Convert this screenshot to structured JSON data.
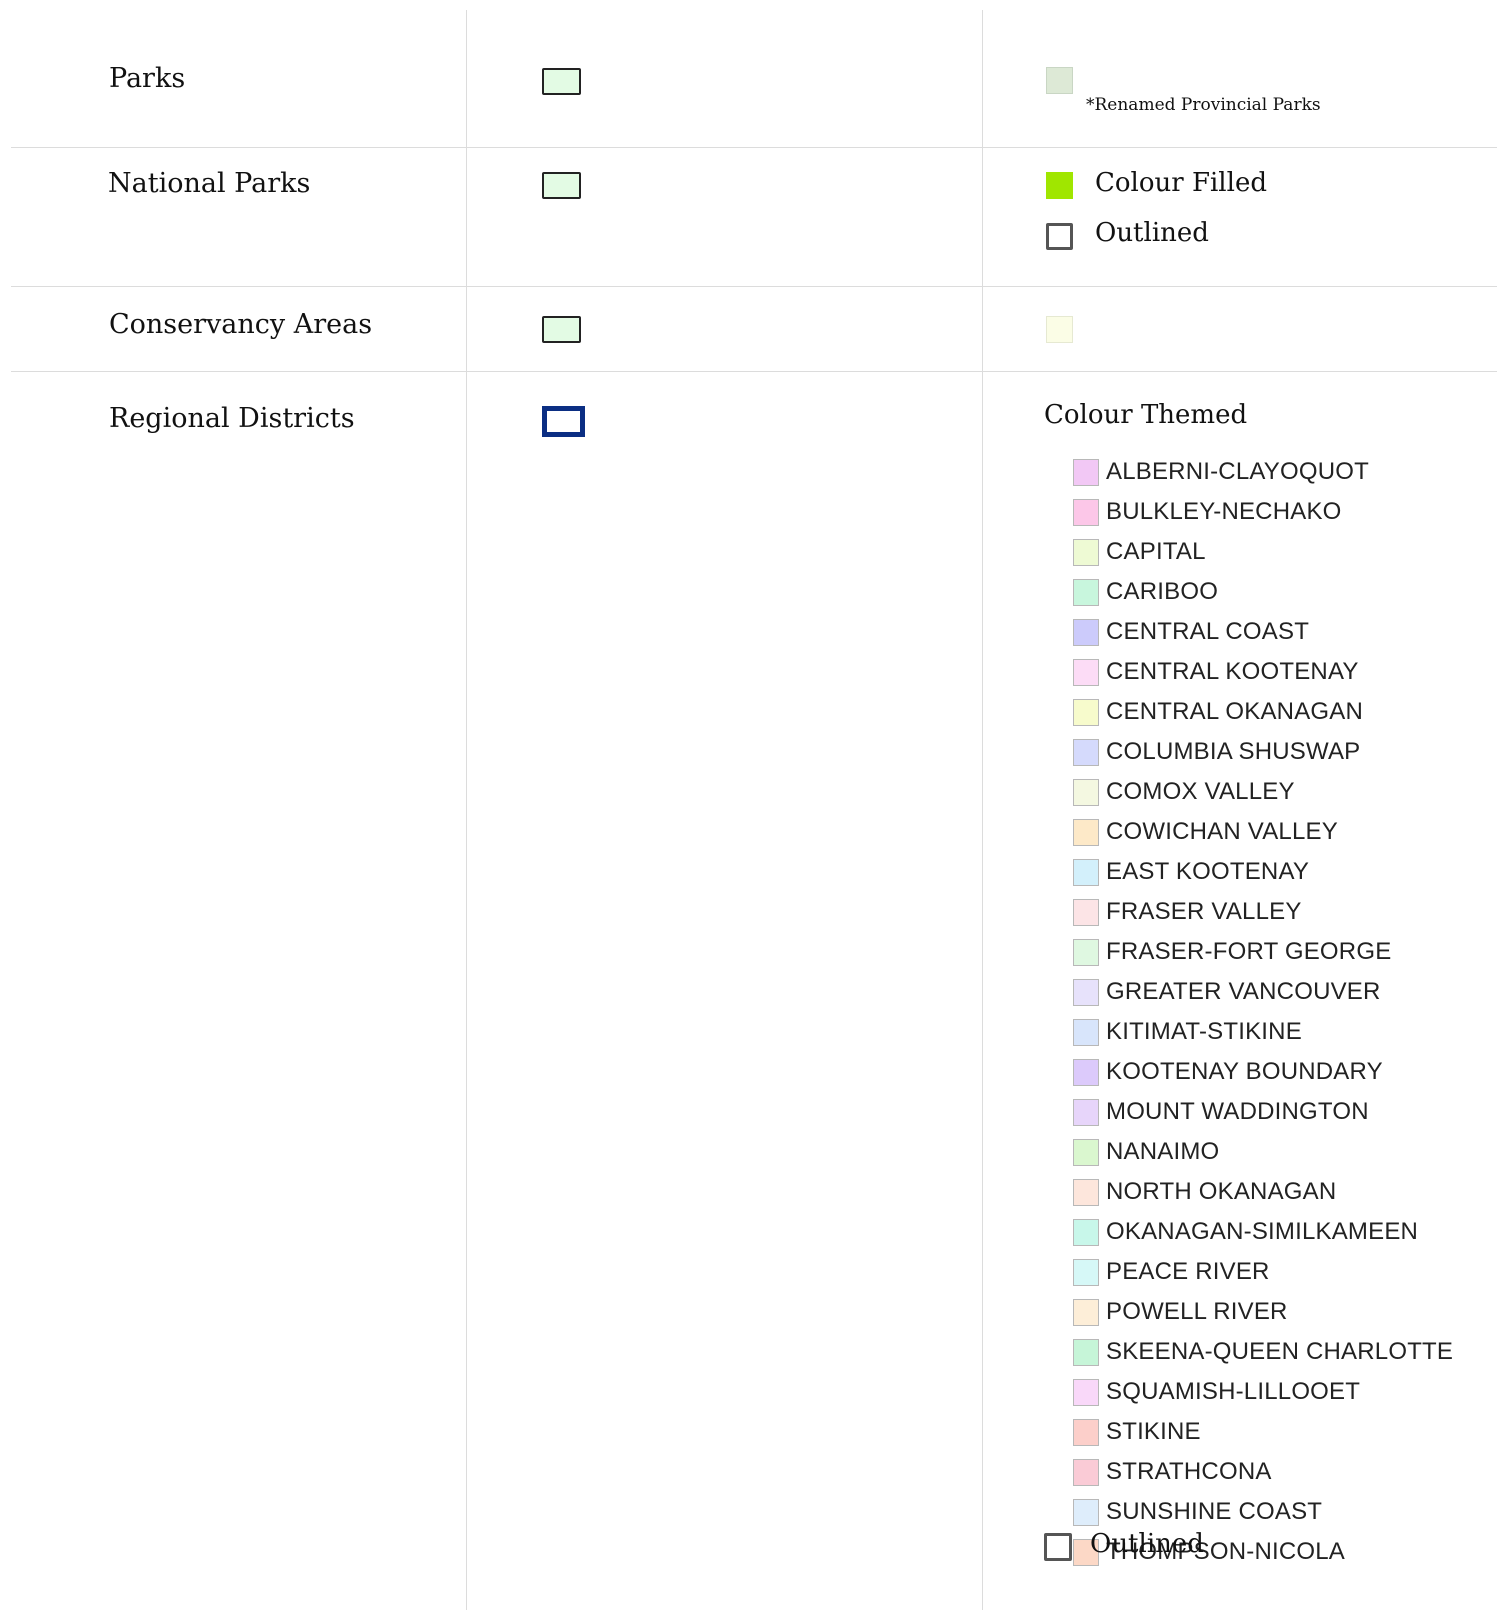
{
  "rows": [
    {
      "name": "Parks",
      "note": "*Renamed Provincial Parks",
      "swatch_color": "#dde9d6"
    },
    {
      "name": "National Parks",
      "fill_label": "Colour Filled",
      "fill_color": "#a0e600",
      "outline_label": "Outlined"
    },
    {
      "name": "Conservancy Areas",
      "swatch_color": "#fbfde6"
    },
    {
      "name": "Regional Districts",
      "themed_label": "Colour Themed",
      "outline_label": "Outlined",
      "outline_color": "#0b2e83"
    }
  ],
  "symbol_fill_color": "#e3fbe4",
  "districts": [
    {
      "name": "ALBERNI-CLAYOQUOT",
      "color": "#f2c8f5"
    },
    {
      "name": "BULKLEY-NECHAKO",
      "color": "#fcc7e8"
    },
    {
      "name": "CAPITAL",
      "color": "#eefad4"
    },
    {
      "name": "CARIBOO",
      "color": "#c8f6dd"
    },
    {
      "name": "CENTRAL COAST",
      "color": "#cccbfb"
    },
    {
      "name": "CENTRAL KOOTENAY",
      "color": "#fcdcf6"
    },
    {
      "name": "CENTRAL OKANAGAN",
      "color": "#f7fbcc"
    },
    {
      "name": "COLUMBIA SHUSWAP",
      "color": "#d5dafc"
    },
    {
      "name": "COMOX VALLEY",
      "color": "#f4f8e1"
    },
    {
      "name": "COWICHAN VALLEY",
      "color": "#fde9c8"
    },
    {
      "name": "EAST KOOTENAY",
      "color": "#d3f0fb"
    },
    {
      "name": "FRASER VALLEY",
      "color": "#fce4e6"
    },
    {
      "name": "FRASER-FORT GEORGE",
      "color": "#dff8e1"
    },
    {
      "name": "GREATER VANCOUVER",
      "color": "#e7e2fb"
    },
    {
      "name": "KITIMAT-STIKINE",
      "color": "#d8e5fb"
    },
    {
      "name": "KOOTENAY BOUNDARY",
      "color": "#dccafb"
    },
    {
      "name": "MOUNT WADDINGTON",
      "color": "#e7d5fa"
    },
    {
      "name": "NANAIMO",
      "color": "#daf7cf"
    },
    {
      "name": "NORTH OKANAGAN",
      "color": "#fde6dc"
    },
    {
      "name": "OKANAGAN-SIMILKAMEEN",
      "color": "#c8f7ea"
    },
    {
      "name": "PEACE RIVER",
      "color": "#d6f8f7"
    },
    {
      "name": "POWELL RIVER",
      "color": "#fdeed8"
    },
    {
      "name": "SKEENA-QUEEN CHARLOTTE",
      "color": "#c6f5d8"
    },
    {
      "name": "SQUAMISH-LILLOOET",
      "color": "#f9d8f9"
    },
    {
      "name": "STIKINE",
      "color": "#fccfca"
    },
    {
      "name": "STRATHCONA",
      "color": "#facbd6"
    },
    {
      "name": "SUNSHINE COAST",
      "color": "#deedfb"
    },
    {
      "name": "THOMPSON-NICOLA",
      "color": "#fcd8c6"
    }
  ]
}
